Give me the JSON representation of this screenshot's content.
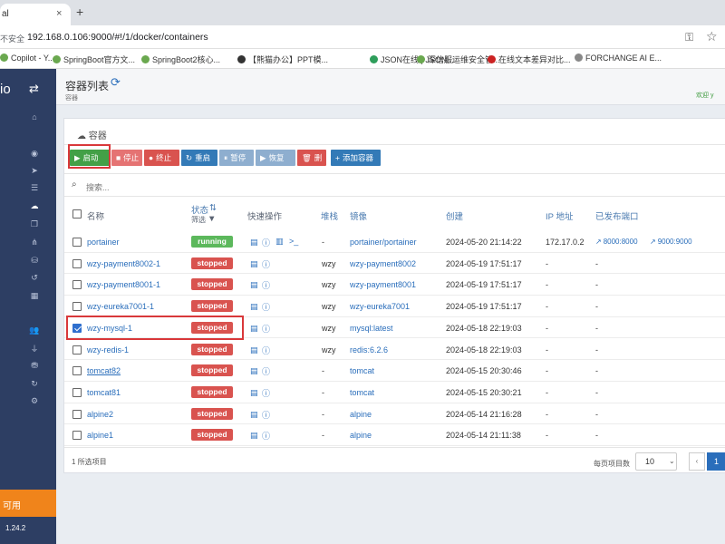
{
  "browser": {
    "tab_label": "al",
    "tab_close": "×",
    "new_tab": "+",
    "insecure": "不安全",
    "url": "192.168.0.106:9000/#!/1/docker/containers"
  },
  "bookmarks": [
    {
      "label": "Copilot - Y...",
      "color": "#6aa84f"
    },
    {
      "label": "SpringBoot官方文...",
      "color": "#6aa84f"
    },
    {
      "label": "SpringBoot2核心...",
      "color": "#6aa84f"
    },
    {
      "label": "【熊猫办公】PPT模...",
      "color": "#333333"
    },
    {
      "label": "JSON在线 | JSON...",
      "color": "#555555"
    },
    {
      "label": "JSON在线 | JSON...",
      "color": "#2e9e5b"
    },
    {
      "label": "深信服运维安全管...",
      "color": "#6aa84f"
    },
    {
      "label": "在线文本差异对比...",
      "color": "#cc2222"
    },
    {
      "label": "FORCHANGE AI E...",
      "color": "#888888"
    }
  ],
  "sidebar": {
    "brand": "io",
    "available": "可用",
    "version": "1.24.2"
  },
  "header": {
    "title": "容器列表",
    "subtitle": "容器",
    "user": "欢迎 y"
  },
  "panel": {
    "title": "容器",
    "search_placeholder": "搜索..."
  },
  "actions": [
    {
      "label": "启动",
      "icon": "▶",
      "color": "#43a047"
    },
    {
      "label": "停止",
      "icon": "■",
      "color": "#e57373"
    },
    {
      "label": "终止",
      "icon": "●",
      "color": "#d9534f"
    },
    {
      "label": "重启",
      "icon": "↻",
      "color": "#337ab7"
    },
    {
      "label": "暂停",
      "icon": "⏸",
      "color": "#8eaecf"
    },
    {
      "label": "恢复",
      "icon": "▶",
      "color": "#8eaecf"
    },
    {
      "label": "删除",
      "icon": "🗑",
      "color": "#d9534f"
    },
    {
      "label": "添加容器",
      "icon": "+",
      "color": "#337ab7"
    }
  ],
  "columns": {
    "name": "名称",
    "state": "状态",
    "state_sort": "⇅",
    "filter": "筛选",
    "quick": "快速操作",
    "stack": "堆栈",
    "image": "镜像",
    "created": "创建",
    "ip": "IP 地址",
    "ports": "已发布端口"
  },
  "rows": [
    {
      "name": "portainer",
      "state": "running",
      "stack": "-",
      "image": "portainer/portainer",
      "created": "2024-05-20 21:14:22",
      "ip": "172.17.0.2",
      "ports": [
        "8000:8000",
        "9000:9000"
      ],
      "checked": false,
      "extra_actions": true
    },
    {
      "name": "wzy-payment8002-1",
      "state": "stopped",
      "stack": "wzy",
      "image": "wzy-payment8002",
      "created": "2024-05-19 17:51:17",
      "ip": "-",
      "ports": [
        "-"
      ],
      "checked": false,
      "extra_actions": false
    },
    {
      "name": "wzy-payment8001-1",
      "state": "stopped",
      "stack": "wzy",
      "image": "wzy-payment8001",
      "created": "2024-05-19 17:51:17",
      "ip": "-",
      "ports": [
        "-"
      ],
      "checked": false,
      "extra_actions": false
    },
    {
      "name": "wzy-eureka7001-1",
      "state": "stopped",
      "stack": "wzy",
      "image": "wzy-eureka7001",
      "created": "2024-05-19 17:51:17",
      "ip": "-",
      "ports": [
        "-"
      ],
      "checked": false,
      "extra_actions": false
    },
    {
      "name": "wzy-mysql-1",
      "state": "stopped",
      "stack": "wzy",
      "image": "mysql:latest",
      "created": "2024-05-18 22:19:03",
      "ip": "-",
      "ports": [
        "-"
      ],
      "checked": true,
      "extra_actions": false
    },
    {
      "name": "wzy-redis-1",
      "state": "stopped",
      "stack": "wzy",
      "image": "redis:6.2.6",
      "created": "2024-05-18 22:19:03",
      "ip": "-",
      "ports": [
        "-"
      ],
      "checked": false,
      "extra_actions": false
    },
    {
      "name": "tomcat82",
      "state": "stopped",
      "stack": "-",
      "image": "tomcat",
      "created": "2024-05-15 20:30:46",
      "ip": "-",
      "ports": [
        "-"
      ],
      "checked": false,
      "extra_actions": false
    },
    {
      "name": "tomcat81",
      "state": "stopped",
      "stack": "-",
      "image": "tomcat",
      "created": "2024-05-15 20:30:21",
      "ip": "-",
      "ports": [
        "-"
      ],
      "checked": false,
      "extra_actions": false
    },
    {
      "name": "alpine2",
      "state": "stopped",
      "stack": "-",
      "image": "alpine",
      "created": "2024-05-14 21:16:28",
      "ip": "-",
      "ports": [
        "-"
      ],
      "checked": false,
      "extra_actions": false
    },
    {
      "name": "alpine1",
      "state": "stopped",
      "stack": "-",
      "image": "alpine",
      "created": "2024-05-14 21:11:38",
      "ip": "-",
      "ports": [
        "-"
      ],
      "checked": false,
      "extra_actions": false
    }
  ],
  "state_colors": {
    "running": "#5cb85c",
    "stopped": "#d9534f"
  },
  "footer": {
    "selected": "1 所选项目",
    "per_page_label": "每页项目数",
    "per_page": "10",
    "prev": "‹",
    "page": "1"
  }
}
